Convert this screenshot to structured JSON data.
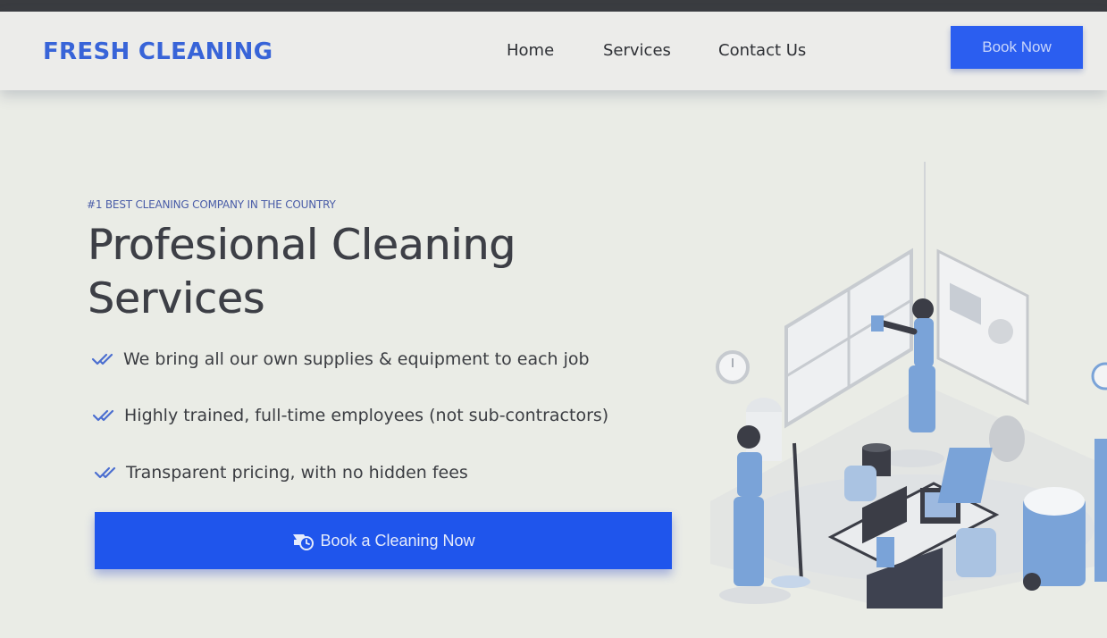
{
  "header": {
    "logo": "FRESH CLEANING",
    "nav": {
      "home": "Home",
      "services": "Services",
      "contact": "Contact Us"
    },
    "book_now": "Book Now"
  },
  "hero": {
    "eyebrow": "#1 BEST CLEANING COMPANY IN THE COUNTRY",
    "title_line1": "Profesional Cleaning",
    "title_line2": "Services",
    "features": [
      "We bring all our own supplies & equipment to each job",
      "Highly trained, full-time employees (not sub-contractors)",
      "Transparent pricing, with no hidden fees"
    ],
    "cta_label": "Book a Cleaning Now",
    "feature_icon": "double-check-icon",
    "cta_icon": "cleaning-clock-icon"
  },
  "colors": {
    "brand": "#3864d8",
    "button": "#2b5ef0",
    "cta": "#1f55ec",
    "illustration_blue": "#7aa3d8"
  }
}
